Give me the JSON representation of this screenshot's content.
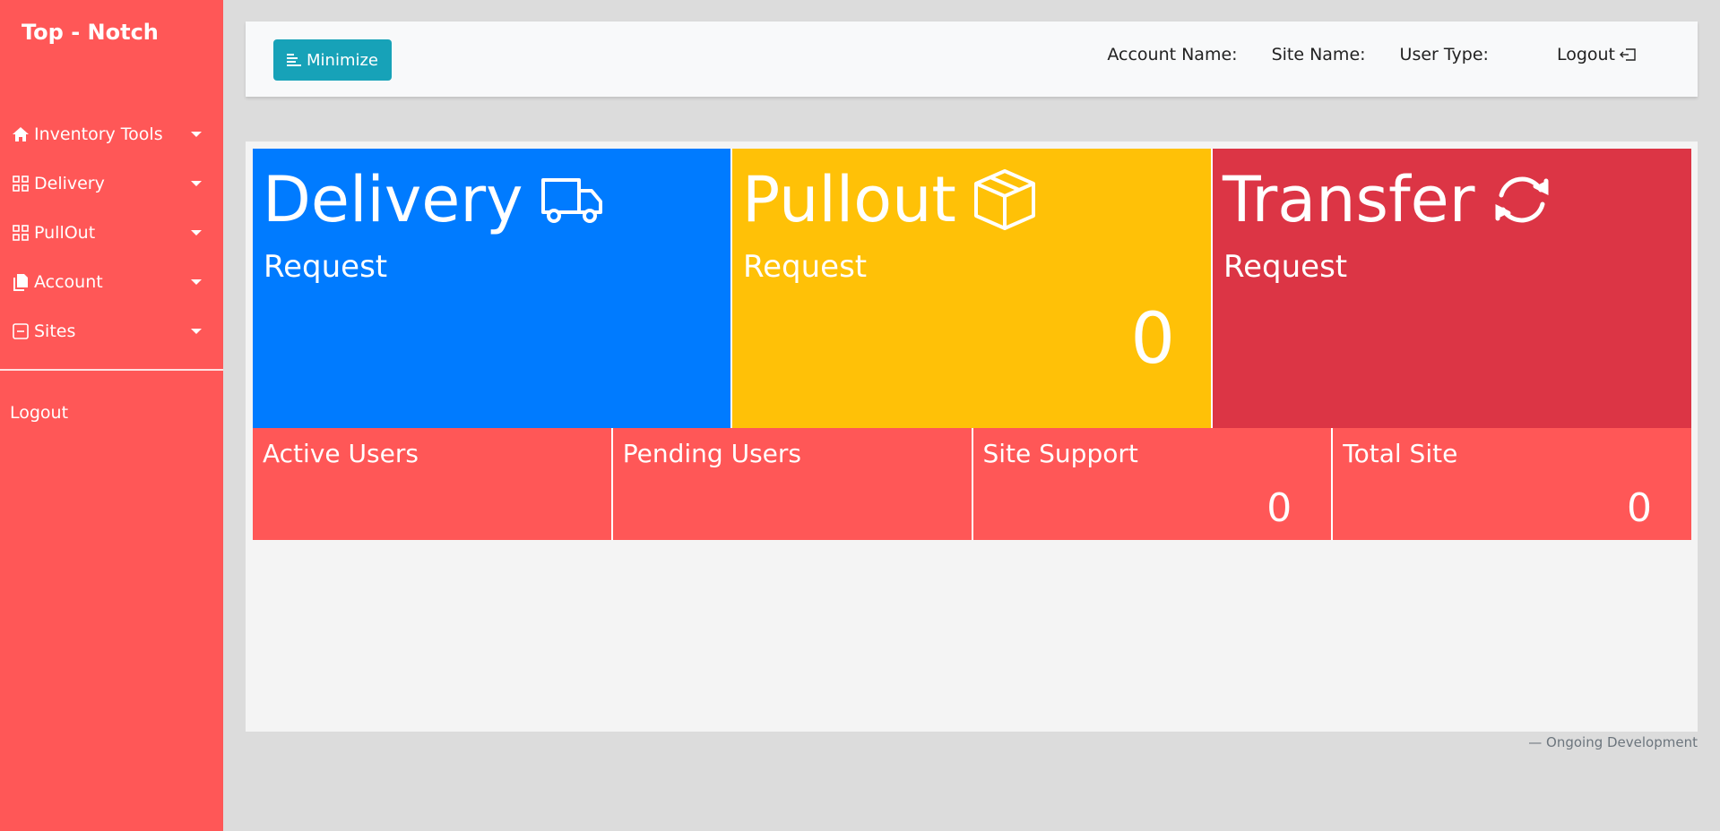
{
  "sidebar": {
    "brand": "Top - Notch",
    "items": [
      {
        "label": "Inventory Tools",
        "icon": "home-icon"
      },
      {
        "label": "Delivery",
        "icon": "grid-icon"
      },
      {
        "label": "PullOut",
        "icon": "grid-icon"
      },
      {
        "label": "Account",
        "icon": "files-icon"
      },
      {
        "label": "Sites",
        "icon": "minus-square-icon"
      }
    ],
    "logout": "Logout"
  },
  "topbar": {
    "minimize_label": "Minimize",
    "account_name": "Account Name:",
    "site_name": "Site Name:",
    "user_type": "User Type:",
    "logout": "Logout"
  },
  "cards": [
    {
      "title": "Delivery",
      "sub": "Request",
      "count": "",
      "icon": "truck-icon",
      "color": "#007bff"
    },
    {
      "title": "Pullout",
      "sub": "Request",
      "count": "0",
      "icon": "box-icon",
      "color": "#ffc107"
    },
    {
      "title": "Transfer",
      "sub": "Request",
      "count": "",
      "icon": "refresh-icon",
      "color": "#dc3545"
    }
  ],
  "stats": [
    {
      "label": "Active Users",
      "count": ""
    },
    {
      "label": "Pending Users",
      "count": ""
    },
    {
      "label": "Site Support",
      "count": "0"
    },
    {
      "label": "Total Site",
      "count": "0"
    }
  ],
  "footer": "— Ongoing Development",
  "colors": {
    "sidebar": "#ff5757",
    "minimize_button": "#17a2b8",
    "stat_bg": "#ff5757"
  }
}
